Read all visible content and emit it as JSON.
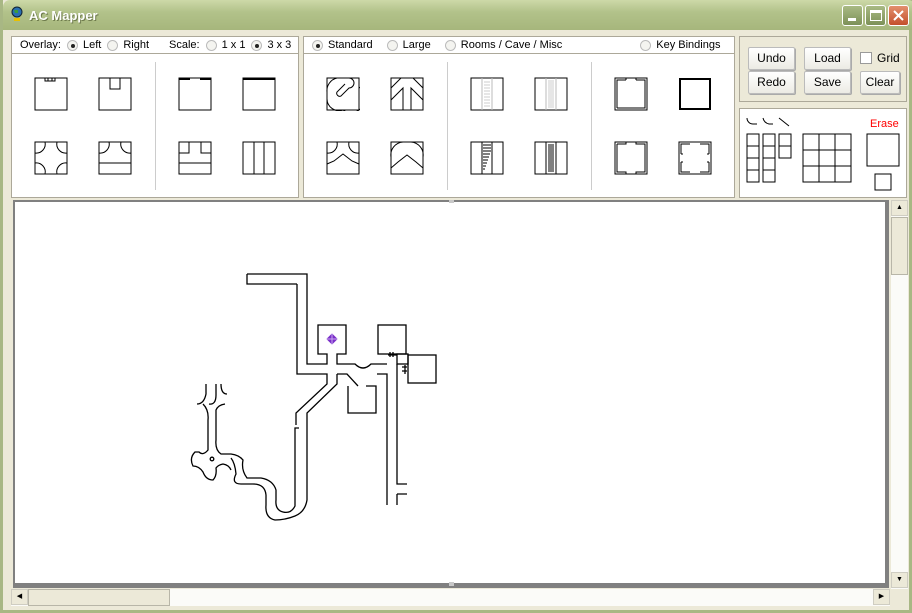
{
  "window": {
    "title": "AC Mapper",
    "minimize": "minimize",
    "maximize": "maximize",
    "close": "close"
  },
  "overlay": {
    "label": "Overlay:",
    "options": [
      {
        "label": "Left",
        "selected": true
      },
      {
        "label": "Right",
        "selected": false
      }
    ]
  },
  "scale": {
    "label": "Scale:",
    "options": [
      {
        "label": "1 x 1",
        "selected": false
      },
      {
        "label": "3 x 3",
        "selected": true
      }
    ]
  },
  "tileset": {
    "options": [
      {
        "label": "Standard",
        "selected": true
      },
      {
        "label": "Large",
        "selected": false
      },
      {
        "label": "Rooms / Cave / Misc",
        "selected": false
      }
    ],
    "key_bindings": {
      "label": "Key Bindings",
      "selected": false
    }
  },
  "actions": {
    "undo": "Undo",
    "redo": "Redo",
    "load": "Load",
    "save": "Save",
    "clear": "Clear",
    "grid": {
      "label": "Grid",
      "checked": false
    }
  },
  "brush": {
    "erase": "Erase",
    "erase_color": "#ff0000"
  },
  "map": {
    "marker_color": "#7a2fc9"
  },
  "scrollbars": {
    "vertical": "map-vertical-scrollbar",
    "horizontal": "map-horizontal-scrollbar"
  }
}
